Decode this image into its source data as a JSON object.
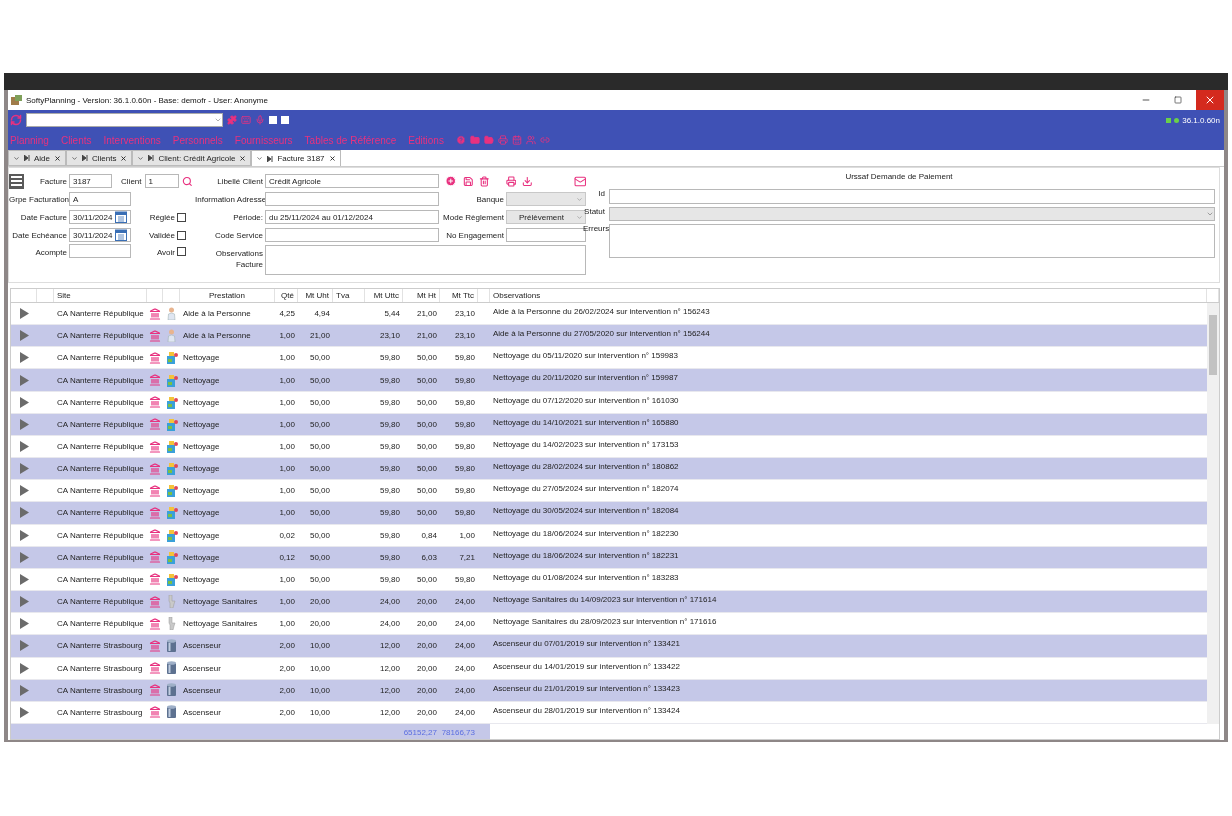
{
  "window": {
    "title": "SoftyPlanning - Version: 36.1.0.60n - Base: demofr - User: Anonyme"
  },
  "toolbar": {
    "version": "36.1.0.60n"
  },
  "menu": [
    "Planning",
    "Clients",
    "Interventions",
    "Personnels",
    "Fournisseurs",
    "Tables de Référence",
    "Editions"
  ],
  "tabs": [
    {
      "label": "Aide",
      "selected": false
    },
    {
      "label": "Clients",
      "selected": false
    },
    {
      "label": "Client: Crédit Agricole",
      "selected": false
    },
    {
      "label": "Facture 3187",
      "selected": true
    }
  ],
  "form": {
    "facture": {
      "label": "Facture",
      "value": "3187"
    },
    "client": {
      "label": "Client",
      "value": "1"
    },
    "libelle_client": {
      "label": "Libellé Client",
      "value": "Crédit Agricole"
    },
    "grpe_facturation": {
      "label": "Grpe Facturation",
      "value": "A"
    },
    "information_adresse": {
      "label": "Information Adresse"
    },
    "banque": {
      "label": "Banque"
    },
    "date_facture": {
      "label": "Date Facture",
      "value": "30/11/2024"
    },
    "reglee": {
      "label": "Réglée",
      "checked": false
    },
    "periode": {
      "label": "Période:",
      "value": "du 25/11/2024 au 01/12/2024"
    },
    "mode_reglement": {
      "label": "Mode Règlement",
      "value": "Prélèvement"
    },
    "date_echeance": {
      "label": "Date Echéance",
      "value": "30/11/2024"
    },
    "validee": {
      "label": "Validée",
      "checked": false
    },
    "code_service": {
      "label": "Code Service"
    },
    "no_engagement": {
      "label": "No Engagement"
    },
    "acompte": {
      "label": "Acompte"
    },
    "avoir": {
      "label": "Avoir",
      "checked": false
    },
    "observations_facture": {
      "label": "Observations Facture"
    }
  },
  "urssaf": {
    "title": "Urssaf Demande de Paiement",
    "id": {
      "label": "Id"
    },
    "statut": {
      "label": "Statut"
    },
    "erreurs": {
      "label": "Erreurs"
    }
  },
  "grid": {
    "columns": [
      "Site",
      "Prestation",
      "Qté",
      "Mt Uht",
      "Tva",
      "Mt Uttc",
      "Mt Ht",
      "Mt Ttc",
      "Observations"
    ],
    "rows": [
      {
        "site": "CA Nanterre République",
        "kind": "aide",
        "prestation": "Aide à la Personne",
        "qte": "4,25",
        "mt_uht": "4,94",
        "mt_uttc": "5,44",
        "mt_ht": "21,00",
        "mt_ttc": "23,10",
        "observations": "Aide à la Personne du 26/02/2024 sur intervention n° 156243"
      },
      {
        "site": "CA Nanterre République",
        "kind": "aide",
        "prestation": "Aide à la Personne",
        "qte": "1,00",
        "mt_uht": "21,00",
        "mt_uttc": "23,10",
        "mt_ht": "21,00",
        "mt_ttc": "23,10",
        "observations": "Aide à la Personne du 27/05/2020 sur intervention n° 156244"
      },
      {
        "site": "CA Nanterre République",
        "kind": "nettoyage",
        "prestation": "Nettoyage",
        "qte": "1,00",
        "mt_uht": "50,00",
        "mt_uttc": "59,80",
        "mt_ht": "50,00",
        "mt_ttc": "59,80",
        "observations": "Nettoyage du 05/11/2020 sur intervention n° 159983"
      },
      {
        "site": "CA Nanterre République",
        "kind": "nettoyage",
        "prestation": "Nettoyage",
        "qte": "1,00",
        "mt_uht": "50,00",
        "mt_uttc": "59,80",
        "mt_ht": "50,00",
        "mt_ttc": "59,80",
        "observations": "Nettoyage du 20/11/2020 sur intervention n° 159987"
      },
      {
        "site": "CA Nanterre République",
        "kind": "nettoyage",
        "prestation": "Nettoyage",
        "qte": "1,00",
        "mt_uht": "50,00",
        "mt_uttc": "59,80",
        "mt_ht": "50,00",
        "mt_ttc": "59,80",
        "observations": "Nettoyage du 07/12/2020 sur intervention n° 161030"
      },
      {
        "site": "CA Nanterre République",
        "kind": "nettoyage",
        "prestation": "Nettoyage",
        "qte": "1,00",
        "mt_uht": "50,00",
        "mt_uttc": "59,80",
        "mt_ht": "50,00",
        "mt_ttc": "59,80",
        "observations": "Nettoyage du 14/10/2021 sur intervention n° 165880"
      },
      {
        "site": "CA Nanterre République",
        "kind": "nettoyage",
        "prestation": "Nettoyage",
        "qte": "1,00",
        "mt_uht": "50,00",
        "mt_uttc": "59,80",
        "mt_ht": "50,00",
        "mt_ttc": "59,80",
        "observations": "Nettoyage du 14/02/2023 sur intervention n° 173153"
      },
      {
        "site": "CA Nanterre République",
        "kind": "nettoyage",
        "prestation": "Nettoyage",
        "qte": "1,00",
        "mt_uht": "50,00",
        "mt_uttc": "59,80",
        "mt_ht": "50,00",
        "mt_ttc": "59,80",
        "observations": "Nettoyage du 28/02/2024 sur intervention n° 180862"
      },
      {
        "site": "CA Nanterre République",
        "kind": "nettoyage",
        "prestation": "Nettoyage",
        "qte": "1,00",
        "mt_uht": "50,00",
        "mt_uttc": "59,80",
        "mt_ht": "50,00",
        "mt_ttc": "59,80",
        "observations": "Nettoyage du 27/05/2024 sur intervention n° 182074"
      },
      {
        "site": "CA Nanterre République",
        "kind": "nettoyage",
        "prestation": "Nettoyage",
        "qte": "1,00",
        "mt_uht": "50,00",
        "mt_uttc": "59,80",
        "mt_ht": "50,00",
        "mt_ttc": "59,80",
        "observations": "Nettoyage du 30/05/2024 sur intervention n° 182084"
      },
      {
        "site": "CA Nanterre République",
        "kind": "nettoyage",
        "prestation": "Nettoyage",
        "qte": "0,02",
        "mt_uht": "50,00",
        "mt_uttc": "59,80",
        "mt_ht": "0,84",
        "mt_ttc": "1,00",
        "observations": "Nettoyage du 18/06/2024 sur intervention n° 182230"
      },
      {
        "site": "CA Nanterre République",
        "kind": "nettoyage",
        "prestation": "Nettoyage",
        "qte": "0,12",
        "mt_uht": "50,00",
        "mt_uttc": "59,80",
        "mt_ht": "6,03",
        "mt_ttc": "7,21",
        "observations": "Nettoyage du 18/06/2024 sur intervention n° 182231"
      },
      {
        "site": "CA Nanterre République",
        "kind": "nettoyage",
        "prestation": "Nettoyage",
        "qte": "1,00",
        "mt_uht": "50,00",
        "mt_uttc": "59,80",
        "mt_ht": "50,00",
        "mt_ttc": "59,80",
        "observations": "Nettoyage du 01/08/2024 sur intervention n° 183283"
      },
      {
        "site": "CA Nanterre République",
        "kind": "sanitaires",
        "prestation": "Nettoyage Sanitaires",
        "qte": "1,00",
        "mt_uht": "20,00",
        "mt_uttc": "24,00",
        "mt_ht": "20,00",
        "mt_ttc": "24,00",
        "observations": "Nettoyage Sanitaires du 14/09/2023 sur intervention n° 171614"
      },
      {
        "site": "CA Nanterre République",
        "kind": "sanitaires",
        "prestation": "Nettoyage Sanitaires",
        "qte": "1,00",
        "mt_uht": "20,00",
        "mt_uttc": "24,00",
        "mt_ht": "20,00",
        "mt_ttc": "24,00",
        "observations": "Nettoyage Sanitaires du 28/09/2023 sur intervention n° 171616"
      },
      {
        "site": "CA Nanterre Strasbourg",
        "kind": "ascenseur",
        "prestation": "Ascenseur",
        "qte": "2,00",
        "mt_uht": "10,00",
        "mt_uttc": "12,00",
        "mt_ht": "20,00",
        "mt_ttc": "24,00",
        "observations": "Ascenseur du 07/01/2019 sur intervention n° 133421"
      },
      {
        "site": "CA Nanterre Strasbourg",
        "kind": "ascenseur",
        "prestation": "Ascenseur",
        "qte": "2,00",
        "mt_uht": "10,00",
        "mt_uttc": "12,00",
        "mt_ht": "20,00",
        "mt_ttc": "24,00",
        "observations": "Ascenseur du 14/01/2019 sur intervention n° 133422"
      },
      {
        "site": "CA Nanterre Strasbourg",
        "kind": "ascenseur",
        "prestation": "Ascenseur",
        "qte": "2,00",
        "mt_uht": "10,00",
        "mt_uttc": "12,00",
        "mt_ht": "20,00",
        "mt_ttc": "24,00",
        "observations": "Ascenseur du 21/01/2019 sur intervention n° 133423"
      },
      {
        "site": "CA Nanterre Strasbourg",
        "kind": "ascenseur",
        "prestation": "Ascenseur",
        "qte": "2,00",
        "mt_uht": "10,00",
        "mt_uttc": "12,00",
        "mt_ht": "20,00",
        "mt_ttc": "24,00",
        "observations": "Ascenseur du 28/01/2019 sur intervention n° 133424"
      }
    ],
    "totals": {
      "mt_ht": "65152,27",
      "mt_ttc": "78166,73"
    }
  }
}
